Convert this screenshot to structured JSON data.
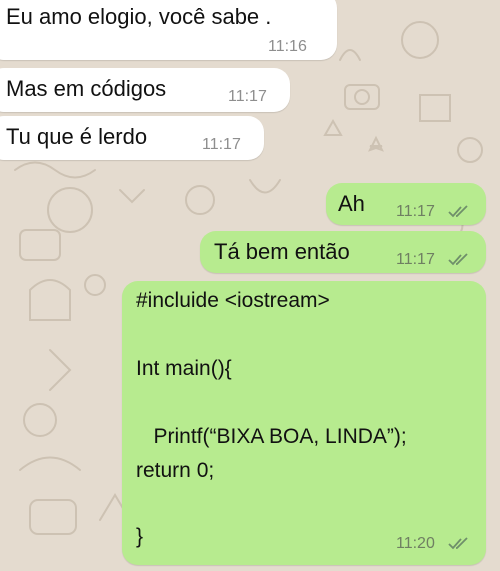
{
  "colors": {
    "wallpaper": "#e4dbcf",
    "incoming_bubble": "#ffffff",
    "outgoing_bubble": "#b7eb8f",
    "read_ticks": "#6f8f6a"
  },
  "messages": [
    {
      "direction": "incoming",
      "text": "Eu amo elogio, você sabe .",
      "time": "11:16"
    },
    {
      "direction": "incoming",
      "text": "Mas em códigos",
      "time": "11:17"
    },
    {
      "direction": "incoming",
      "text": "Tu que é lerdo",
      "time": "11:17"
    },
    {
      "direction": "outgoing",
      "text": "Ah",
      "time": "11:17",
      "status": "read-double-check-icon"
    },
    {
      "direction": "outgoing",
      "text": "Tá bem então",
      "time": "11:17",
      "status": "read-double-check-icon"
    },
    {
      "direction": "outgoing",
      "time": "11:20",
      "status": "read-double-check-icon",
      "lines": [
        "#incluide <iostream>",
        "Int main(){",
        "   Printf(“BIXA BOA, LINDA”);",
        "return 0;",
        "}"
      ]
    }
  ]
}
